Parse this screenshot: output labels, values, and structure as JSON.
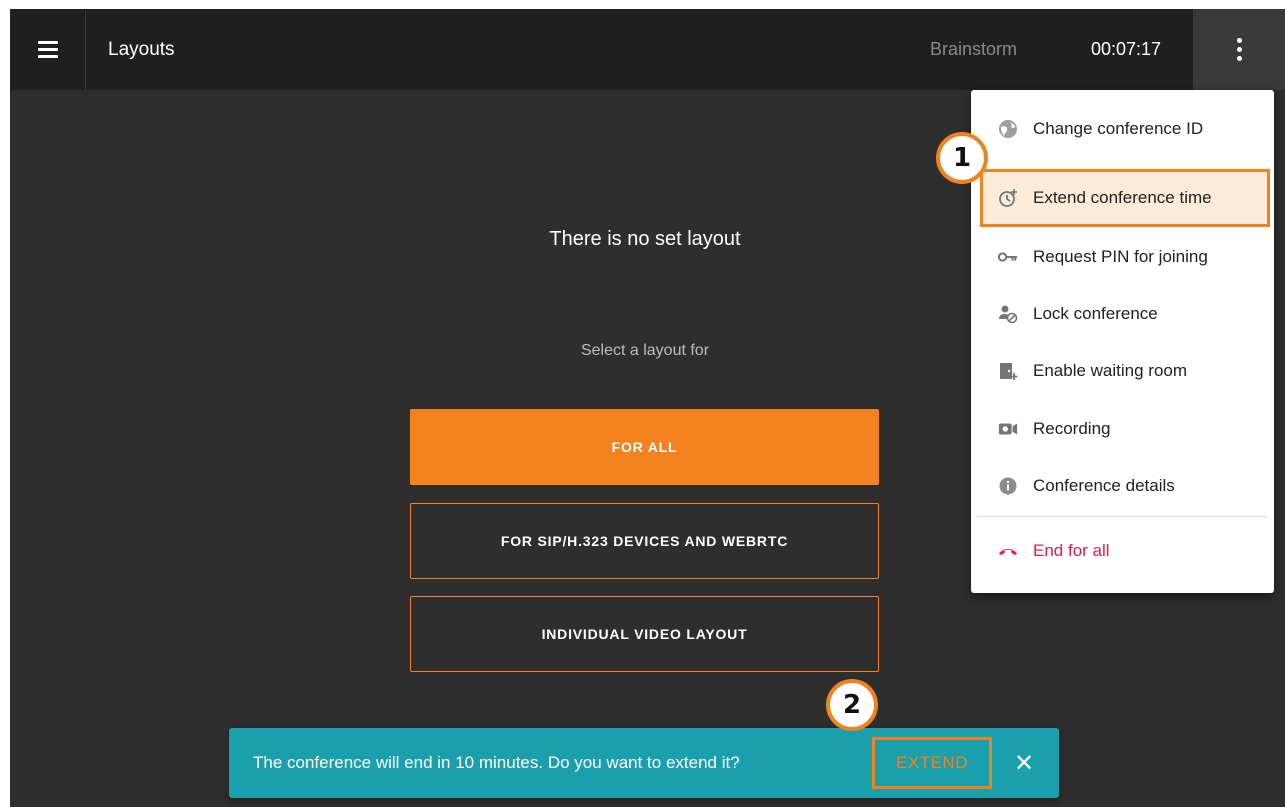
{
  "header": {
    "title": "Layouts",
    "conference_name": "Brainstorm",
    "timer": "00:07:17"
  },
  "main": {
    "empty_message": "There is no set layout",
    "select_prompt": "Select a layout for",
    "buttons": {
      "for_all": "FOR ALL",
      "sip": "FOR SIP/H.323 DEVICES AND WEBRTC",
      "individual": "INDIVIDUAL VIDEO LAYOUT"
    }
  },
  "menu": {
    "items": [
      {
        "label": "Change conference ID",
        "icon": "globe-icon"
      },
      {
        "label": "Extend conference time",
        "icon": "clock-plus-icon"
      },
      {
        "label": "Request PIN for joining",
        "icon": "key-icon"
      },
      {
        "label": "Lock conference",
        "icon": "user-lock-icon"
      },
      {
        "label": "Enable waiting room",
        "icon": "door-icon"
      },
      {
        "label": "Recording",
        "icon": "video-camera-icon"
      },
      {
        "label": "Conference details",
        "icon": "info-icon"
      },
      {
        "label": "End for all",
        "icon": "hang-up-icon"
      }
    ]
  },
  "callouts": {
    "one": "1",
    "two": "2"
  },
  "snackbar": {
    "message": "The conference will end in 10 minutes. Do you want to extend it?",
    "action": "EXTEND",
    "close": "✕"
  },
  "colors": {
    "accent": "#f3821e",
    "background": "#2e2e2e",
    "topbar": "#1f1f1f",
    "snackbar": "#1aa0ad",
    "danger": "#e8194a",
    "highlight": "#fdebd9"
  }
}
